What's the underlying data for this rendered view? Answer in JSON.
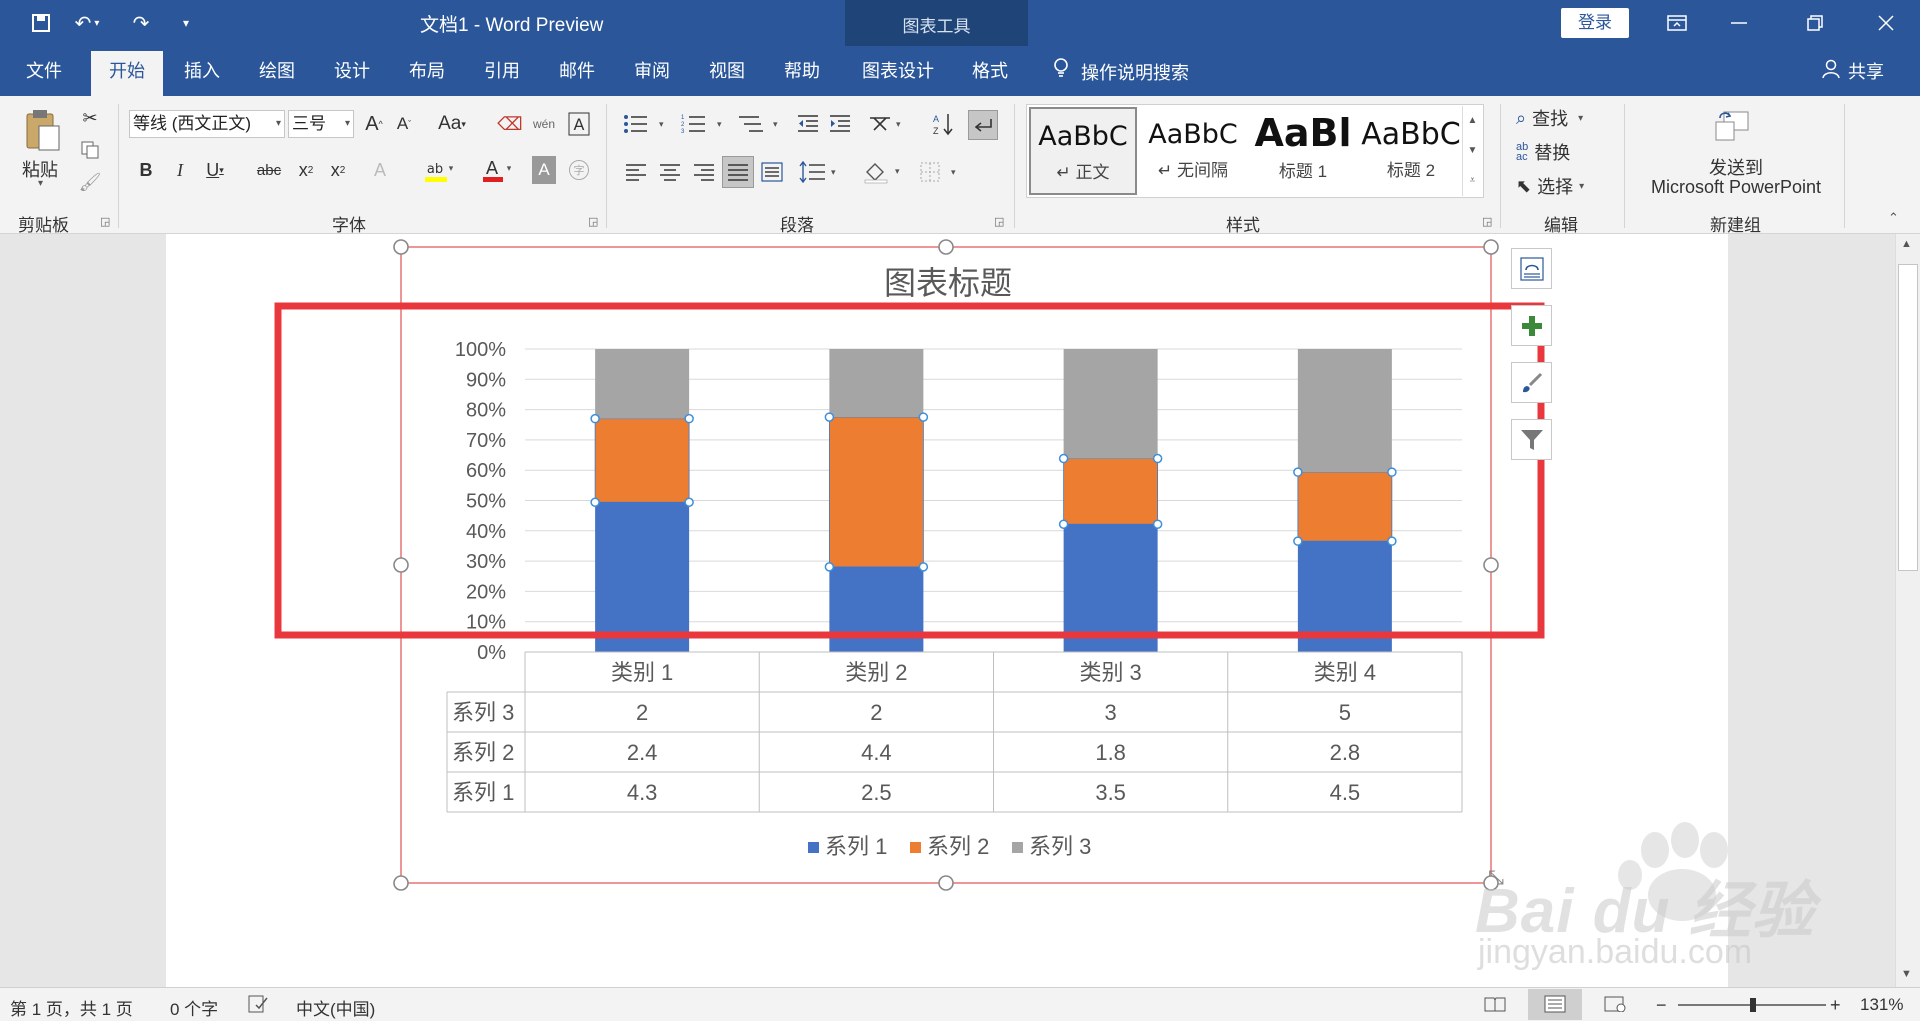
{
  "titlebar": {
    "doc_title": "文档1  -  Word Preview",
    "chart_tools": "图表工具",
    "login": "登录",
    "qat_icons": [
      "save-icon",
      "undo-icon",
      "redo-icon",
      "customize-icon"
    ]
  },
  "tabs": [
    "文件",
    "开始",
    "插入",
    "绘图",
    "设计",
    "布局",
    "引用",
    "邮件",
    "审阅",
    "视图",
    "帮助",
    "图表设计",
    "格式"
  ],
  "search_tell": "操作说明搜索",
  "share": "共享",
  "ribbon": {
    "clipboard": {
      "paste": "粘贴",
      "label": "剪贴板"
    },
    "font": {
      "name": "等线 (西文正文)",
      "size": "三号",
      "label": "字体"
    },
    "paragraph": {
      "label": "段落"
    },
    "styles": {
      "label": "样式",
      "items": [
        {
          "preview": "AaBbC",
          "name": "↵ 正文"
        },
        {
          "preview": "AaBbC",
          "name": "↵ 无间隔"
        },
        {
          "preview": "AaBl",
          "name": "标题 1"
        },
        {
          "preview": "AaBbC",
          "name": "标题 2"
        }
      ]
    },
    "editing": {
      "find": "查找",
      "replace": "替换",
      "select": "选择",
      "label": "编辑"
    },
    "newgroup": {
      "send_line1": "发送到",
      "send_line2": "Microsoft PowerPoint",
      "label": "新建组"
    }
  },
  "chart_data": {
    "type": "bar",
    "stacked": "percent",
    "title": "图表标题",
    "categories": [
      "类别 1",
      "类别 2",
      "类别 3",
      "类别 4"
    ],
    "series": [
      {
        "name": "系列 1",
        "values": [
          4.3,
          2.5,
          3.5,
          4.5
        ],
        "color": "#4472c4"
      },
      {
        "name": "系列 2",
        "values": [
          2.4,
          4.4,
          1.8,
          2.8
        ],
        "color": "#ed7d31"
      },
      {
        "name": "系列 3",
        "values": [
          2,
          2,
          3,
          5
        ],
        "color": "#a5a5a5"
      }
    ],
    "yticks": [
      "0%",
      "10%",
      "20%",
      "30%",
      "40%",
      "50%",
      "60%",
      "70%",
      "80%",
      "90%",
      "100%"
    ],
    "ylim": [
      0,
      1
    ],
    "grid": true,
    "data_table": true,
    "legend": "bottom"
  },
  "statusbar": {
    "page": "第 1 页，共 1 页",
    "words": "0 个字",
    "lang": "中文(中国)",
    "zoom": "131%"
  },
  "watermark": {
    "brand": "Bai du 经验",
    "url": "jingyan.baidu.com"
  },
  "colors": {
    "accent": "#2b579a",
    "highlight_box": "#e8383d",
    "selection": "#e05050"
  }
}
